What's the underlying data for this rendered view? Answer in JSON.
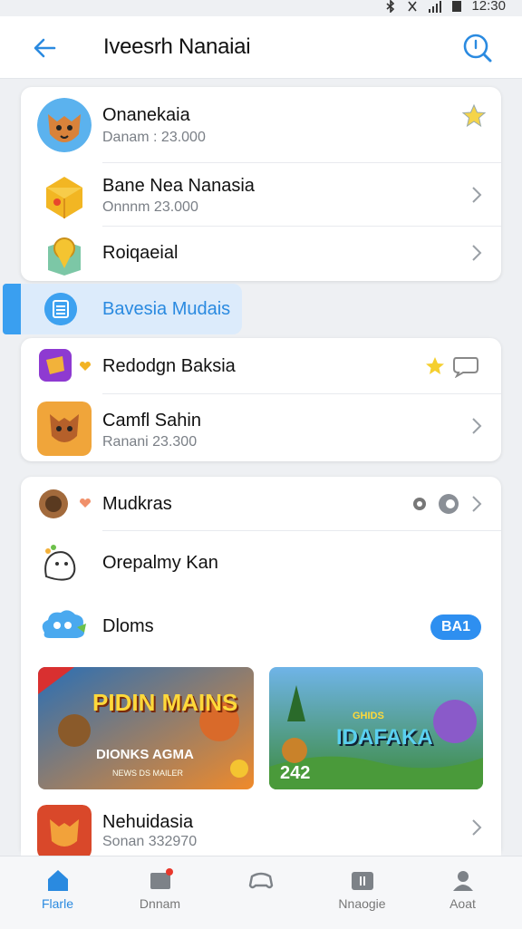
{
  "status_bar": {
    "time": "12:30"
  },
  "header": {
    "title": "Iveesrh Nanaiai"
  },
  "group1": [
    {
      "name": "Onanekaia",
      "sub": "Danam : 23.000",
      "trailing": "star"
    },
    {
      "name": "Bane Nea Nanasia",
      "sub": "Onnnm 23.000",
      "trailing": "chevron"
    },
    {
      "name": "Roiqaeial",
      "sub": "",
      "trailing": "chevron"
    }
  ],
  "selected": {
    "label": "Bavesia Mudais"
  },
  "group2": [
    {
      "name": "Redodgn Baksia",
      "sub": "",
      "trailing": "star-chat"
    },
    {
      "name": "Camfl Sahin",
      "sub": "Ranani 23.300",
      "trailing": "chevron"
    }
  ],
  "group3": [
    {
      "name": "Mudkras",
      "trailing": "settings-toggle"
    },
    {
      "name": "Orepalmy  Kan"
    },
    {
      "name": "Dloms",
      "badge": "BA1"
    }
  ],
  "banners": [
    {
      "title": "PIDIN MAINS",
      "subtitle": "DIONKS AGMA",
      "caption": "NEWS DS MAILER"
    },
    {
      "title": "IDAFAKA",
      "subtitle": "GHIDS",
      "caption": "242"
    }
  ],
  "last_row": {
    "name": "Nehuidasia",
    "sub": "Sonan 332970"
  },
  "bottom_nav": [
    {
      "label": "Flarle",
      "icon": "home-icon"
    },
    {
      "label": "Dnnam",
      "icon": "media-icon"
    },
    {
      "label": "",
      "icon": "controller-icon"
    },
    {
      "label": "Nnaogie",
      "icon": "folder-icon"
    },
    {
      "label": "Aoat",
      "icon": "profile-icon"
    }
  ],
  "colors": {
    "accent": "#2e8ff0",
    "selected_bg": "#dcebfb"
  }
}
